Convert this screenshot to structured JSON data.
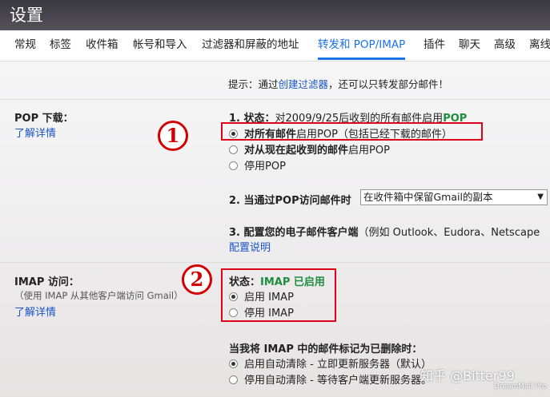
{
  "header": {
    "title": "设置"
  },
  "tabs": [
    {
      "label": "常规"
    },
    {
      "label": "标签"
    },
    {
      "label": "收件箱"
    },
    {
      "label": "帐号和导入"
    },
    {
      "label": "过滤器和屏蔽的地址"
    },
    {
      "label": "转发和 POP/IMAP"
    },
    {
      "label": "插件"
    },
    {
      "label": "聊天"
    },
    {
      "label": "高级"
    },
    {
      "label": "离线"
    }
  ],
  "hint": {
    "prefix": "提示：通过",
    "link": "创建过滤器",
    "suffix": "，还可以只转发部分邮件！"
  },
  "pop": {
    "title": "POP 下载：",
    "learn_more": "了解详情",
    "status_prefix": "1. 状态：",
    "status_text": "对2009/9/25后收到的所有邮件启用",
    "status_value": "POP",
    "options": [
      {
        "bold": "对所有邮件",
        "text": "启用POP（包括已经下载的邮件）",
        "checked": true
      },
      {
        "bold": "对从现在起收到的邮件",
        "text": "启用POP",
        "checked": false
      },
      {
        "bold": "",
        "text": "停用POP",
        "checked": false
      }
    ],
    "access_label": "2. 当通过POP访问邮件时",
    "access_select": "在收件箱中保留Gmail的副本",
    "config_label": "3. 配置您的电子邮件客户端",
    "config_hint": "（例如 Outlook、Eudora、Netscape",
    "config_link": "配置说明"
  },
  "imap": {
    "title": "IMAP 访问：",
    "subtitle": "（使用 IMAP 从其他客户端访问 Gmail）",
    "learn_more": "了解详情",
    "status_prefix": "状态：",
    "status_value": "IMAP 已启用",
    "options": [
      {
        "text": "启用 IMAP",
        "checked": true
      },
      {
        "text": "停用 IMAP",
        "checked": false
      }
    ],
    "delete_title": "当我将 IMAP 中的邮件标记为已删除时：",
    "delete_options": [
      {
        "text": "启用自动清除 - 立即更新服务器（默认）",
        "checked": true
      },
      {
        "text": "停用自动清除 - 等待客户端更新服务器。",
        "checked": false
      }
    ]
  },
  "annotations": {
    "one": "1",
    "two": "2"
  },
  "watermark": {
    "text": "知乎 @Bitter99",
    "brand": "DreamMail Pro"
  },
  "colors": {
    "accent": "#1a73e8",
    "link": "#1a56c8",
    "status_green": "#1e8e3e",
    "annotation_red": "#e0001a"
  }
}
